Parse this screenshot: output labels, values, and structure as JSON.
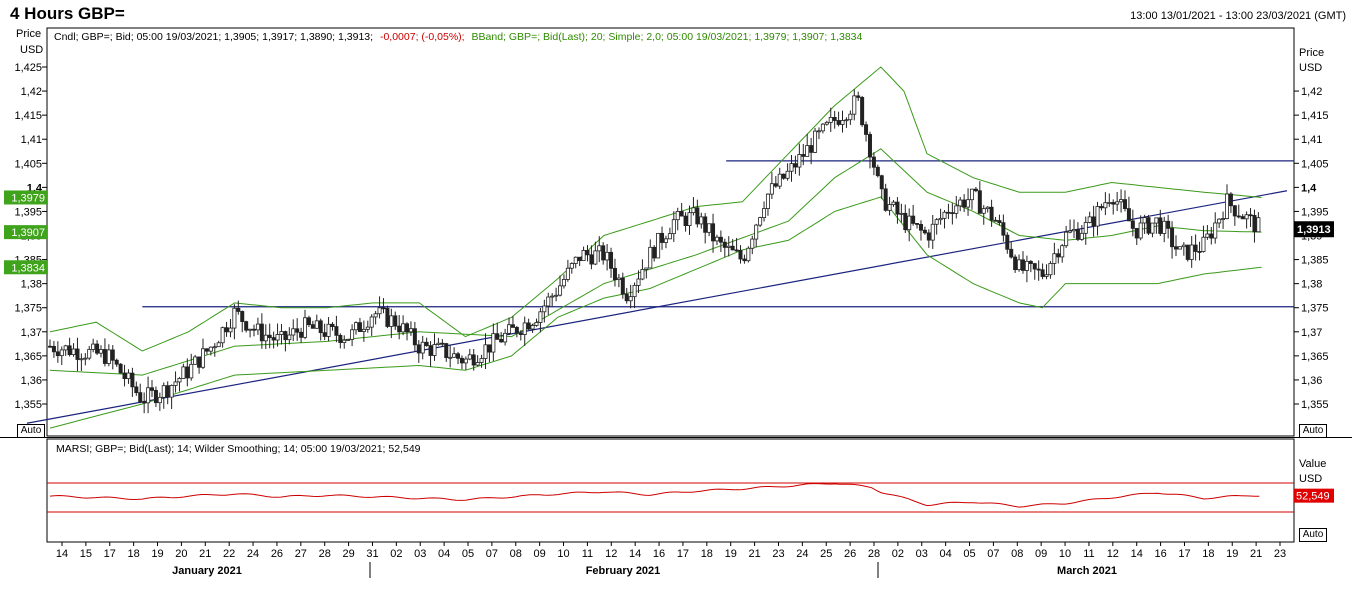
{
  "header": {
    "title": "4 Hours GBP=",
    "range": "13:00 13/01/2021 - 13:00 23/03/2021 (GMT)"
  },
  "price_panel": {
    "ylabel_left": "Price",
    "unit_left": "USD",
    "ylabel_right": "Price",
    "unit_right": "USD",
    "legend": [
      {
        "text": "Cndl; GBP=; Bid; 05:00 19/03/2021; 1,3905; 1,3917; 1,3890; 1,3913;",
        "color": "#000000"
      },
      {
        "text": "-0,0007; (-0,05%);",
        "color": "#cc0000"
      },
      {
        "text": "BBand; GBP=; Bid(Last);  20; Simple; 2,0; 05:00 19/03/2021; 1,3979; 1,3907; 1,3834",
        "color": "#2e8b00"
      }
    ],
    "left_badges": [
      {
        "label": "1,3979",
        "value": 1.3979,
        "color": "#3fa41c"
      },
      {
        "label": "1,3907",
        "value": 1.3907,
        "color": "#3fa41c"
      },
      {
        "label": "1,3834",
        "value": 1.3834,
        "color": "#3fa41c"
      }
    ],
    "right_badge": {
      "label": "1,3913",
      "value": 1.3913,
      "color": "#000000"
    },
    "auto_label": "Auto"
  },
  "rsi_panel": {
    "legend": "MARSI; GBP=; Bid(Last);  14; Wilder Smoothing; 14; 05:00 19/03/2021; 52,549",
    "legend_color": "#cc0000",
    "ylabel": "Value",
    "unit": "USD",
    "badge": {
      "label": "52,549",
      "value": 52.549,
      "color": "#e00000"
    },
    "auto_label": "Auto"
  },
  "x_axis": {
    "day_labels": [
      "14",
      "15",
      "17",
      "18",
      "19",
      "20",
      "21",
      "22",
      "24",
      "26",
      "27",
      "28",
      "29",
      "31",
      "02",
      "03",
      "04",
      "05",
      "07",
      "08",
      "09",
      "10",
      "11",
      "12",
      "14",
      "16",
      "17",
      "18",
      "19",
      "21",
      "23",
      "24",
      "25",
      "26",
      "28",
      "02",
      "03",
      "04",
      "05",
      "07",
      "08",
      "09",
      "10",
      "11",
      "12",
      "14",
      "16",
      "17",
      "18",
      "19",
      "21",
      "23"
    ],
    "month_labels": [
      "January 2021",
      "February 2021",
      "March 2021"
    ]
  },
  "chart_data": [
    {
      "type": "candlestick",
      "title": "4 Hours GBP=",
      "ylabel": "Price USD",
      "ylim": [
        1.351,
        1.4285
      ],
      "y_ticks": [
        "1,355",
        "1,36",
        "1,365",
        "1,37",
        "1,375",
        "1,38",
        "1,385",
        "1,39",
        "1,395",
        "1,4",
        "1,405",
        "1,41",
        "1,415",
        "1,42",
        "1,425"
      ],
      "y_ticks_right": [
        "1,355",
        "1,36",
        "1,365",
        "1,37",
        "1,375",
        "1,38",
        "1,385",
        "1,39",
        "1,395",
        "1,4",
        "1,405",
        "1,41",
        "1,415",
        "1,42"
      ],
      "x_range": [
        "14/01/2021",
        "23/03/2021"
      ],
      "close_trend": [
        [
          0,
          1.367
        ],
        [
          2.5,
          1.365
        ],
        [
          4,
          1.356
        ],
        [
          5,
          1.358
        ],
        [
          6,
          1.362
        ],
        [
          7,
          1.367
        ],
        [
          8,
          1.374
        ],
        [
          9,
          1.37
        ],
        [
          10,
          1.368
        ],
        [
          11,
          1.371
        ],
        [
          12,
          1.37
        ],
        [
          13,
          1.369
        ],
        [
          14,
          1.374
        ],
        [
          15,
          1.372
        ],
        [
          16,
          1.367
        ],
        [
          17,
          1.366
        ],
        [
          18,
          1.364
        ],
        [
          19,
          1.367
        ],
        [
          20,
          1.37
        ],
        [
          21,
          1.373
        ],
        [
          22,
          1.379
        ],
        [
          23,
          1.386
        ],
        [
          24,
          1.386
        ],
        [
          25,
          1.378
        ],
        [
          26,
          1.386
        ],
        [
          27,
          1.393
        ],
        [
          28,
          1.394
        ],
        [
          29,
          1.388
        ],
        [
          30,
          1.385
        ],
        [
          31,
          1.398
        ],
        [
          32,
          1.403
        ],
        [
          33,
          1.409
        ],
        [
          34,
          1.414
        ],
        [
          35,
          1.418
        ],
        [
          35.6,
          1.407
        ],
        [
          36,
          1.398
        ],
        [
          37,
          1.393
        ],
        [
          38,
          1.39
        ],
        [
          39,
          1.396
        ],
        [
          40,
          1.398
        ],
        [
          41,
          1.393
        ],
        [
          42,
          1.383
        ],
        [
          43,
          1.382
        ],
        [
          44,
          1.39
        ],
        [
          45,
          1.392
        ],
        [
          46,
          1.399
        ],
        [
          47,
          1.391
        ],
        [
          48,
          1.393
        ],
        [
          49,
          1.386
        ],
        [
          50,
          1.388
        ],
        [
          51,
          1.397
        ],
        [
          52,
          1.393
        ],
        [
          52.5,
          1.3913
        ]
      ],
      "bollinger": {
        "period": 20,
        "method": "Simple",
        "stddev": 2.0,
        "last": {
          "upper": 1.3979,
          "middle": 1.3907,
          "lower": 1.3834
        },
        "upper_trend": [
          [
            0,
            1.37
          ],
          [
            2,
            1.372
          ],
          [
            4,
            1.366
          ],
          [
            6,
            1.37
          ],
          [
            8,
            1.376
          ],
          [
            10,
            1.375
          ],
          [
            12,
            1.375
          ],
          [
            14,
            1.376
          ],
          [
            16,
            1.376
          ],
          [
            18,
            1.369
          ],
          [
            20,
            1.373
          ],
          [
            22,
            1.381
          ],
          [
            24,
            1.39
          ],
          [
            26,
            1.393
          ],
          [
            28,
            1.396
          ],
          [
            30,
            1.397
          ],
          [
            32,
            1.407
          ],
          [
            34,
            1.417
          ],
          [
            36,
            1.425
          ],
          [
            37,
            1.42
          ],
          [
            38,
            1.407
          ],
          [
            40,
            1.402
          ],
          [
            42,
            1.399
          ],
          [
            44,
            1.399
          ],
          [
            46,
            1.401
          ],
          [
            48,
            1.4
          ],
          [
            50,
            1.399
          ],
          [
            52.5,
            1.3979
          ]
        ],
        "middle_trend": [
          [
            0,
            1.362
          ],
          [
            4,
            1.361
          ],
          [
            8,
            1.367
          ],
          [
            12,
            1.368
          ],
          [
            16,
            1.37
          ],
          [
            20,
            1.369
          ],
          [
            24,
            1.38
          ],
          [
            28,
            1.386
          ],
          [
            32,
            1.393
          ],
          [
            34,
            1.402
          ],
          [
            36,
            1.408
          ],
          [
            38,
            1.399
          ],
          [
            40,
            1.395
          ],
          [
            42,
            1.39
          ],
          [
            44,
            1.389
          ],
          [
            46,
            1.39
          ],
          [
            48,
            1.392
          ],
          [
            50,
            1.391
          ],
          [
            52.5,
            1.3907
          ]
        ],
        "lower_trend": [
          [
            0,
            1.35
          ],
          [
            4,
            1.355
          ],
          [
            8,
            1.361
          ],
          [
            12,
            1.362
          ],
          [
            16,
            1.363
          ],
          [
            18,
            1.362
          ],
          [
            20,
            1.365
          ],
          [
            22,
            1.373
          ],
          [
            24,
            1.377
          ],
          [
            26,
            1.379
          ],
          [
            28,
            1.383
          ],
          [
            30,
            1.387
          ],
          [
            32,
            1.389
          ],
          [
            34,
            1.395
          ],
          [
            36,
            1.398
          ],
          [
            38,
            1.386
          ],
          [
            40,
            1.38
          ],
          [
            42,
            1.376
          ],
          [
            43,
            1.375
          ],
          [
            44,
            1.38
          ],
          [
            46,
            1.38
          ],
          [
            48,
            1.38
          ],
          [
            50,
            1.382
          ],
          [
            52.5,
            1.3834
          ]
        ]
      },
      "support_resistance": [
        1.4055,
        1.3752
      ],
      "trendline": [
        [
          -1,
          1.351
        ],
        [
          53.6,
          1.3993
        ]
      ]
    },
    {
      "type": "line",
      "title": "MARSI",
      "ylabel": "Value USD",
      "last": 52.549,
      "reference_lines": [
        70,
        30
      ],
      "series_trend": [
        [
          0,
          52
        ],
        [
          4,
          48
        ],
        [
          6,
          52
        ],
        [
          8,
          55
        ],
        [
          10,
          51
        ],
        [
          12,
          53
        ],
        [
          14,
          51
        ],
        [
          16,
          49
        ],
        [
          18,
          47
        ],
        [
          20,
          51
        ],
        [
          22,
          55
        ],
        [
          24,
          58
        ],
        [
          26,
          54
        ],
        [
          28,
          59
        ],
        [
          30,
          62
        ],
        [
          32,
          66
        ],
        [
          34,
          70
        ],
        [
          35.6,
          64
        ],
        [
          36,
          58
        ],
        [
          38,
          40
        ],
        [
          40,
          44
        ],
        [
          42,
          38
        ],
        [
          44,
          42
        ],
        [
          46,
          50
        ],
        [
          48,
          57
        ],
        [
          50,
          49
        ],
        [
          52,
          53
        ],
        [
          52.5,
          52.549
        ]
      ]
    }
  ]
}
